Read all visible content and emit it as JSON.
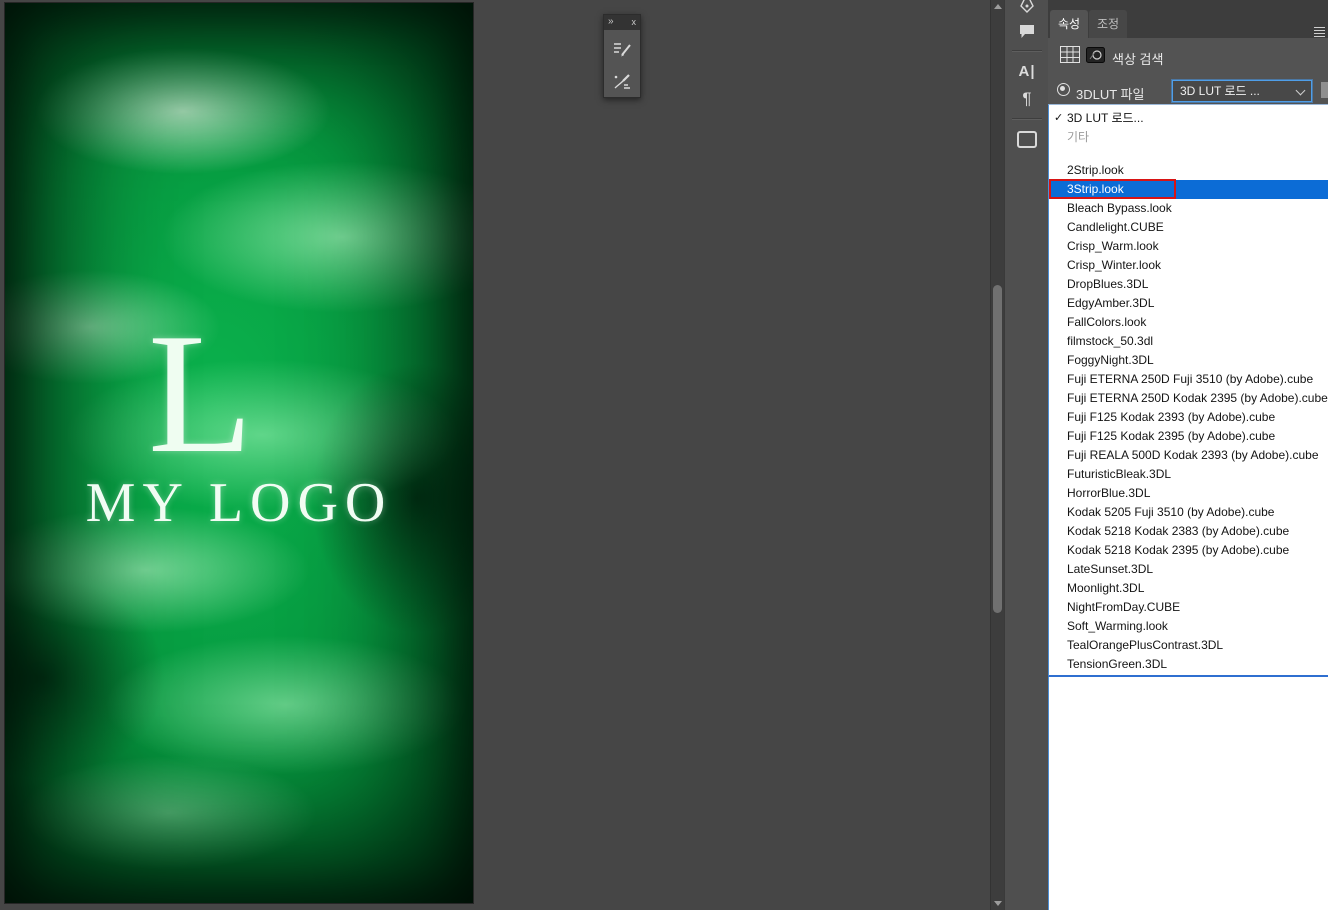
{
  "canvas": {
    "logo_letter": "L",
    "logo_text": "MY LOGO"
  },
  "floating_toolbar": {
    "collapse_glyph": "»",
    "close_glyph": "x"
  },
  "icons": {
    "check_glyph": "✓",
    "character_glyph": "A|",
    "paragraph_glyph": "¶"
  },
  "properties_panel": {
    "tabs": [
      {
        "label": "속성",
        "active": true
      },
      {
        "label": "조정",
        "active": false
      }
    ],
    "header_title": "색상 검색",
    "lut_field": {
      "label": "3DLUT 파일",
      "value": "3D LUT 로드 ..."
    },
    "dropdown": {
      "top_items": [
        {
          "label": "3D LUT 로드...",
          "checked": true
        },
        {
          "label": "기타",
          "checked": false
        }
      ],
      "files": [
        "2Strip.look",
        "3Strip.look",
        "Bleach Bypass.look",
        "Candlelight.CUBE",
        "Crisp_Warm.look",
        "Crisp_Winter.look",
        "DropBlues.3DL",
        "EdgyAmber.3DL",
        "FallColors.look",
        "filmstock_50.3dl",
        "FoggyNight.3DL",
        "Fuji ETERNA 250D Fuji 3510 (by Adobe).cube",
        "Fuji ETERNA 250D Kodak 2395 (by Adobe).cube",
        "Fuji F125 Kodak 2393 (by Adobe).cube",
        "Fuji F125 Kodak 2395 (by Adobe).cube",
        "Fuji REALA 500D Kodak 2393 (by Adobe).cube",
        "FuturisticBleak.3DL",
        "HorrorBlue.3DL",
        "Kodak 5205 Fuji 3510 (by Adobe).cube",
        "Kodak 5218 Kodak 2383 (by Adobe).cube",
        "Kodak 5218 Kodak 2395 (by Adobe).cube",
        "LateSunset.3DL",
        "Moonlight.3DL",
        "NightFromDay.CUBE",
        "Soft_Warming.look",
        "TealOrangePlusContrast.3DL",
        "TensionGreen.3DL"
      ],
      "selected_file": "3Strip.look"
    }
  },
  "colors": {
    "selection_blue": "#0c6cd6",
    "annotation_red": "#d81414",
    "panel_gray": "#535353",
    "canvas_gray": "#464646"
  }
}
